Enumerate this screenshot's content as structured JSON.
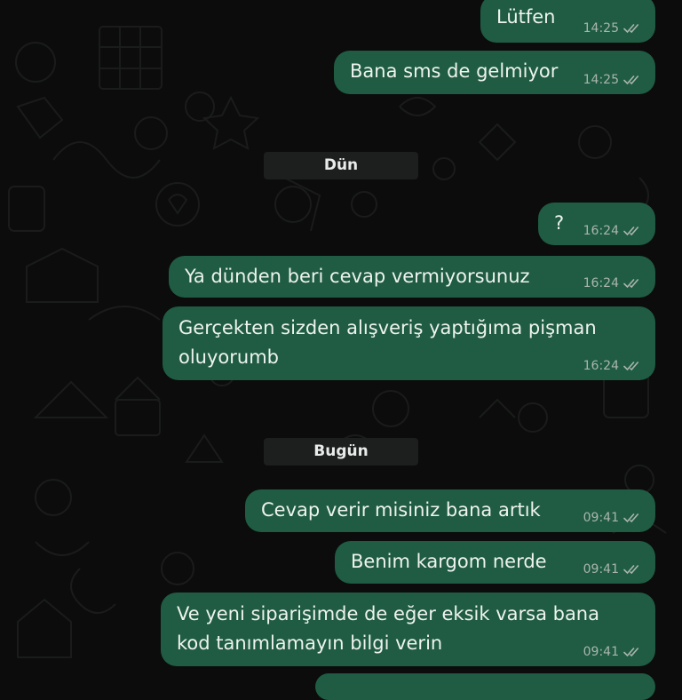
{
  "chat": {
    "date_separators": {
      "yesterday": "Dün",
      "today": "Bugün"
    },
    "messages": [
      {
        "text": "Lütfen",
        "time": "14:25"
      },
      {
        "text": "Bana sms de gelmiyor",
        "time": "14:25"
      },
      {
        "text": "?",
        "time": "16:24"
      },
      {
        "text": "Ya dünden beri cevap vermiyorsunuz",
        "time": "16:24"
      },
      {
        "text": "Gerçekten sizden alışveriş yaptığıma pişman\noluyorumb",
        "time": "16:24"
      },
      {
        "text": "Cevap verir misiniz bana artık",
        "time": "09:41"
      },
      {
        "text": "Benim kargom nerde",
        "time": "09:41"
      },
      {
        "text": "Ve yeni siparişimde de eğer eksik varsa bana\nkod tanımlamayın bilgi verin",
        "time": "09:41"
      }
    ],
    "read_icon": "double-check-icon"
  },
  "colors": {
    "background": "#0b0c0b",
    "outgoing_bubble": "#1f5c43",
    "date_pill": "#1d1f1e",
    "timestamp": "#aab5ad"
  }
}
